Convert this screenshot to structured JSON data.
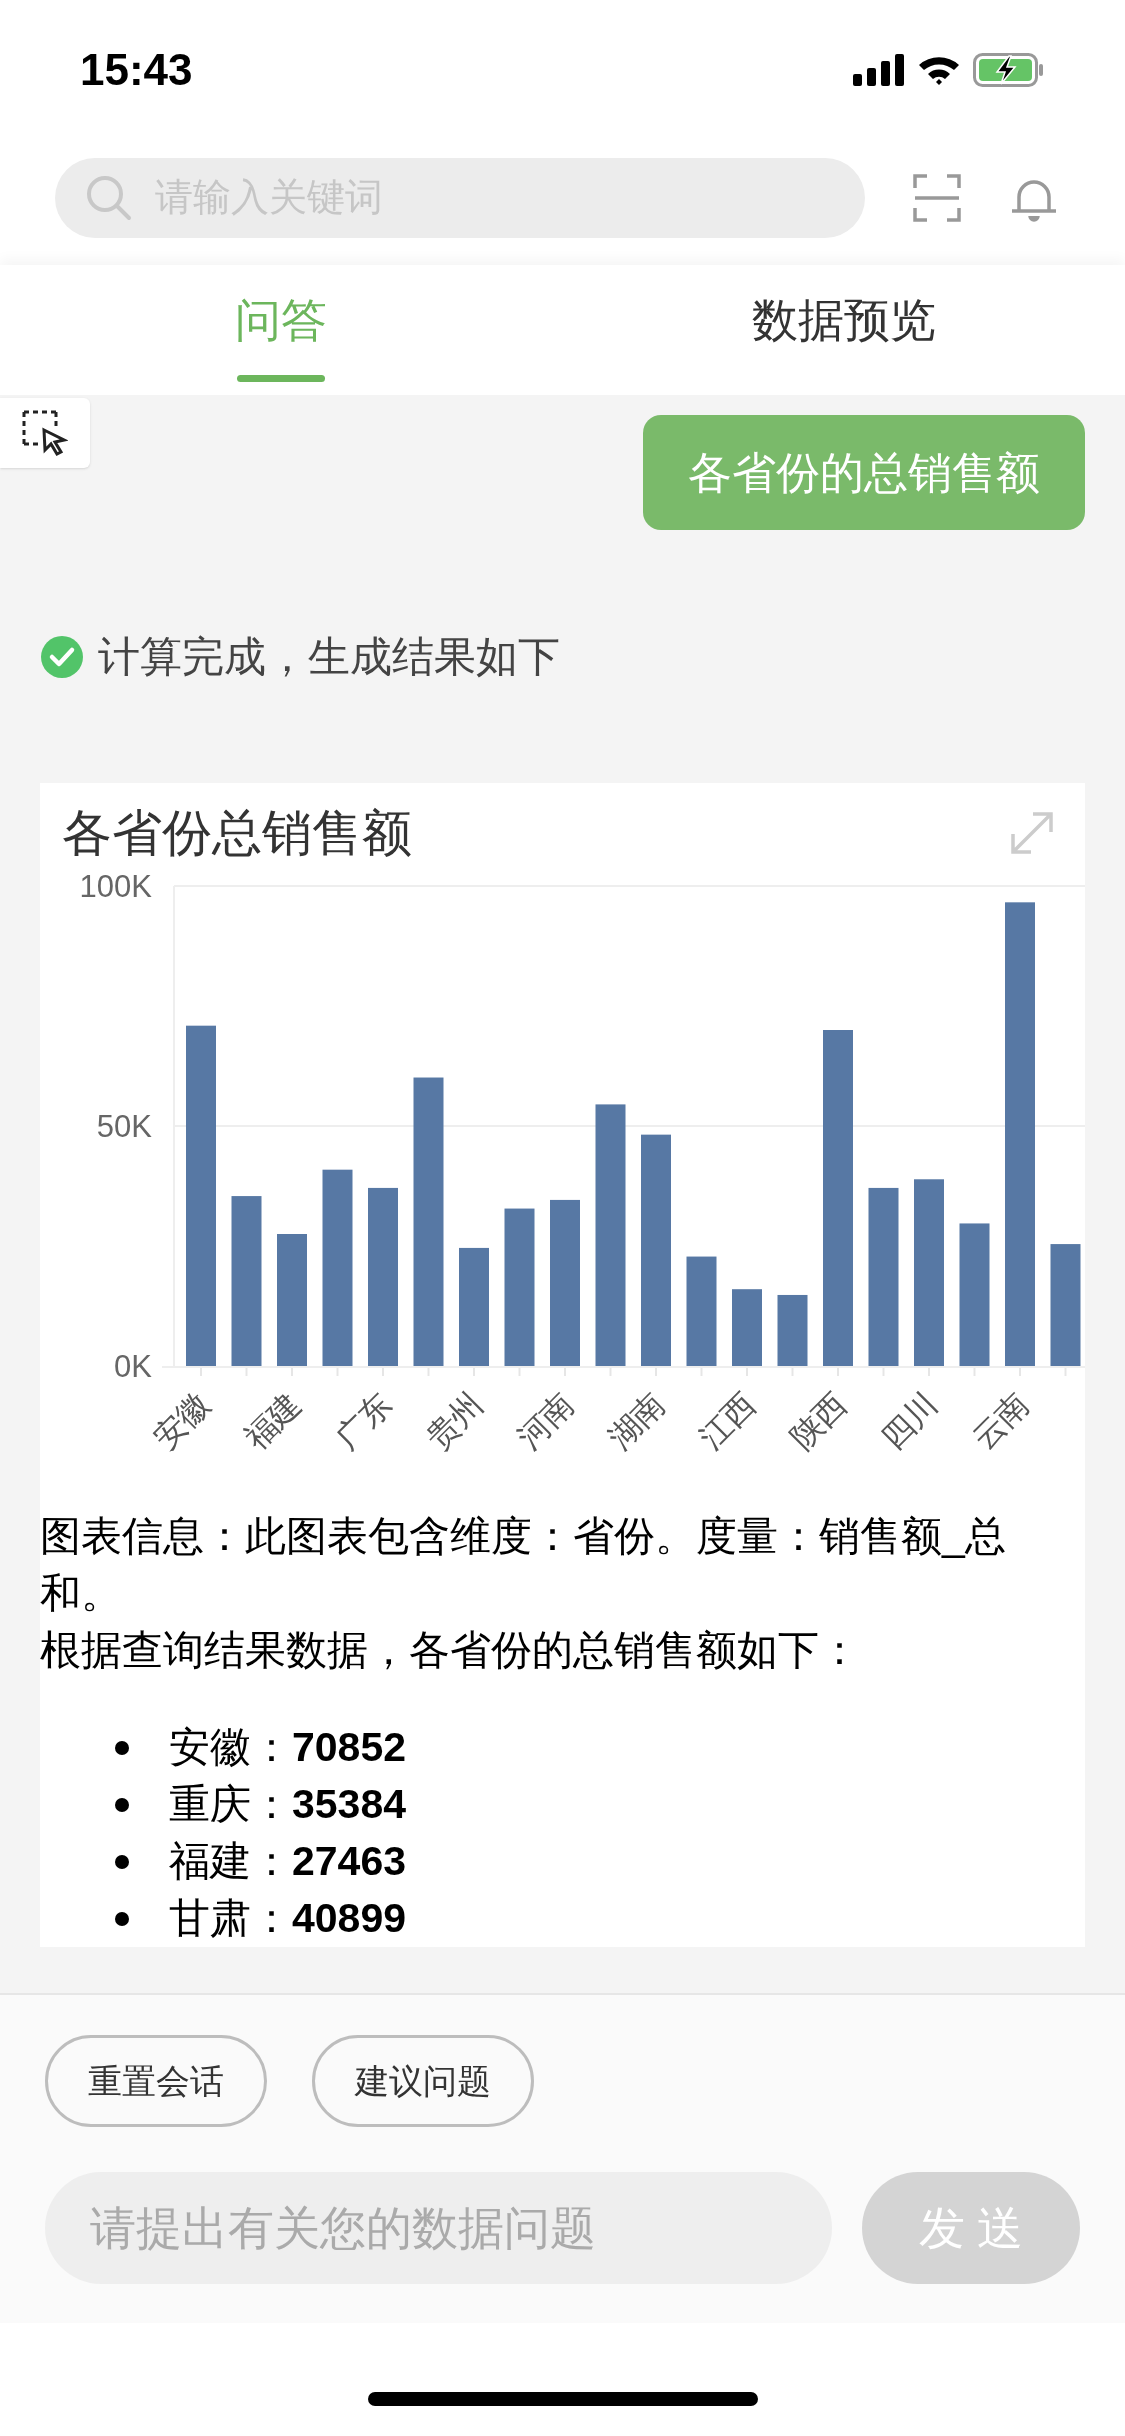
{
  "status_bar": {
    "time": "15:43"
  },
  "search": {
    "placeholder": "请输入关键词"
  },
  "tabs": [
    {
      "label": "问答",
      "selected": true
    },
    {
      "label": "数据预览",
      "selected": false
    }
  ],
  "conversation": {
    "question": "各省份的总销售额",
    "status": {
      "text": "计算完成，生成结果如下",
      "done": true
    },
    "answer": {
      "chart_data": {
        "type": "bar",
        "title": "各省份总销售额",
        "categories": [
          "安徽",
          null,
          "福建",
          null,
          "广东",
          null,
          "贵州",
          null,
          "河南",
          null,
          "湖南",
          null,
          "江西",
          null,
          "陕西",
          null,
          "四川",
          null,
          "云南",
          null
        ],
        "values": [
          70900,
          35400,
          27500,
          40900,
          37100,
          60100,
          24600,
          32800,
          34600,
          54500,
          48200,
          22800,
          16000,
          14800,
          70000,
          37100,
          38900,
          29700,
          96600,
          25400
        ],
        "ylim": [
          0,
          100000
        ],
        "yticks": [
          {
            "value": 0,
            "label": "0K"
          },
          {
            "value": 50000,
            "label": "50K"
          },
          {
            "value": 100000,
            "label": "100K"
          }
        ]
      },
      "summary": [
        "图表信息：此图表包含维度：省份。度量：销售额_总和。",
        "根据查询结果数据，各省份的总销售额如下："
      ],
      "list": [
        "安徽：**70852**",
        "重庆：**35384**",
        "福建：**27463**",
        "甘肃：**40899**"
      ]
    }
  },
  "quick_actions": [
    "重置会话",
    "建议问题"
  ],
  "input": {
    "placeholder": "请提出有关您的数据问题"
  },
  "send_button": "发 送"
}
